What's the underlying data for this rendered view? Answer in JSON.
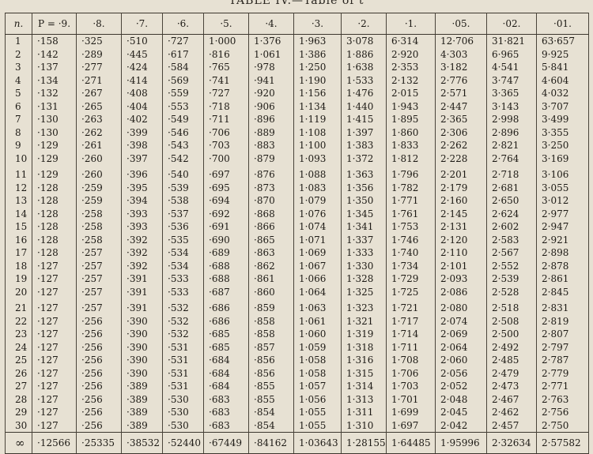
{
  "title": "TABLE IV.—Table of t",
  "columns": [
    "n.",
    "P = ·9.",
    "·8.",
    "·7.",
    "·6.",
    "·5.",
    "·4.",
    "·3.",
    "·2.",
    "·1.",
    "·05.",
    "·02.",
    "·01."
  ],
  "rows": [
    [
      "1",
      "·158",
      "·325",
      "·510",
      "·727",
      "1·000",
      "1·376",
      "1·963",
      "3·078",
      "6·314",
      "12·706",
      "31·821",
      "63·657"
    ],
    [
      "2",
      "·142",
      "·289",
      "·445",
      "·617",
      "·816",
      "1·061",
      "1·386",
      "1·886",
      "2·920",
      "4·303",
      "6·965",
      "9·925"
    ],
    [
      "3",
      "·137",
      "·277",
      "·424",
      "·584",
      "·765",
      "·978",
      "1·250",
      "1·638",
      "2·353",
      "3·182",
      "4·541",
      "5·841"
    ],
    [
      "4",
      "·134",
      "·271",
      "·414",
      "·569",
      "·741",
      "·941",
      "1·190",
      "1·533",
      "2·132",
      "2·776",
      "3·747",
      "4·604"
    ],
    [
      "5",
      "·132",
      "·267",
      "·408",
      "·559",
      "·727",
      "·920",
      "1·156",
      "1·476",
      "2·015",
      "2·571",
      "3·365",
      "4·032"
    ],
    [
      "6",
      "·131",
      "·265",
      "·404",
      "·553",
      "·718",
      "·906",
      "1·134",
      "1·440",
      "1·943",
      "2·447",
      "3·143",
      "3·707"
    ],
    [
      "7",
      "·130",
      "·263",
      "·402",
      "·549",
      "·711",
      "·896",
      "1·119",
      "1·415",
      "1·895",
      "2·365",
      "2·998",
      "3·499"
    ],
    [
      "8",
      "·130",
      "·262",
      "·399",
      "·546",
      "·706",
      "·889",
      "1·108",
      "1·397",
      "1·860",
      "2·306",
      "2·896",
      "3·355"
    ],
    [
      "9",
      "·129",
      "·261",
      "·398",
      "·543",
      "·703",
      "·883",
      "1·100",
      "1·383",
      "1·833",
      "2·262",
      "2·821",
      "3·250"
    ],
    [
      "10",
      "·129",
      "·260",
      "·397",
      "·542",
      "·700",
      "·879",
      "1·093",
      "1·372",
      "1·812",
      "2·228",
      "2·764",
      "3·169"
    ],
    [
      "11",
      "·129",
      "·260",
      "·396",
      "·540",
      "·697",
      "·876",
      "1·088",
      "1·363",
      "1·796",
      "2·201",
      "2·718",
      "3·106"
    ],
    [
      "12",
      "·128",
      "·259",
      "·395",
      "·539",
      "·695",
      "·873",
      "1·083",
      "1·356",
      "1·782",
      "2·179",
      "2·681",
      "3·055"
    ],
    [
      "13",
      "·128",
      "·259",
      "·394",
      "·538",
      "·694",
      "·870",
      "1·079",
      "1·350",
      "1·771",
      "2·160",
      "2·650",
      "3·012"
    ],
    [
      "14",
      "·128",
      "·258",
      "·393",
      "·537",
      "·692",
      "·868",
      "1·076",
      "1·345",
      "1·761",
      "2·145",
      "2·624",
      "2·977"
    ],
    [
      "15",
      "·128",
      "·258",
      "·393",
      "·536",
      "·691",
      "·866",
      "1·074",
      "1·341",
      "1·753",
      "2·131",
      "2·602",
      "2·947"
    ],
    [
      "16",
      "·128",
      "·258",
      "·392",
      "·535",
      "·690",
      "·865",
      "1·071",
      "1·337",
      "1·746",
      "2·120",
      "2·583",
      "2·921"
    ],
    [
      "17",
      "·128",
      "·257",
      "·392",
      "·534",
      "·689",
      "·863",
      "1·069",
      "1·333",
      "1·740",
      "2·110",
      "2·567",
      "2·898"
    ],
    [
      "18",
      "·127",
      "·257",
      "·392",
      "·534",
      "·688",
      "·862",
      "1·067",
      "1·330",
      "1·734",
      "2·101",
      "2·552",
      "2·878"
    ],
    [
      "19",
      "·127",
      "·257",
      "·391",
      "·533",
      "·688",
      "·861",
      "1·066",
      "1·328",
      "1·729",
      "2·093",
      "2·539",
      "2·861"
    ],
    [
      "20",
      "·127",
      "·257",
      "·391",
      "·533",
      "·687",
      "·860",
      "1·064",
      "1·325",
      "1·725",
      "2·086",
      "2·528",
      "2·845"
    ],
    [
      "21",
      "·127",
      "·257",
      "·391",
      "·532",
      "·686",
      "·859",
      "1·063",
      "1·323",
      "1·721",
      "2·080",
      "2·518",
      "2·831"
    ],
    [
      "22",
      "·127",
      "·256",
      "·390",
      "·532",
      "·686",
      "·858",
      "1·061",
      "1·321",
      "1·717",
      "2·074",
      "2·508",
      "2·819"
    ],
    [
      "23",
      "·127",
      "·256",
      "·390",
      "·532",
      "·685",
      "·858",
      "1·060",
      "1·319",
      "1·714",
      "2·069",
      "2·500",
      "2·807"
    ],
    [
      "24",
      "·127",
      "·256",
      "·390",
      "·531",
      "·685",
      "·857",
      "1·059",
      "1·318",
      "1·711",
      "2·064",
      "2·492",
      "2·797"
    ],
    [
      "25",
      "·127",
      "·256",
      "·390",
      "·531",
      "·684",
      "·856",
      "1·058",
      "1·316",
      "1·708",
      "2·060",
      "2·485",
      "2·787"
    ],
    [
      "26",
      "·127",
      "·256",
      "·390",
      "·531",
      "·684",
      "·856",
      "1·058",
      "1·315",
      "1·706",
      "2·056",
      "2·479",
      "2·779"
    ],
    [
      "27",
      "·127",
      "·256",
      "·389",
      "·531",
      "·684",
      "·855",
      "1·057",
      "1·314",
      "1·703",
      "2·052",
      "2·473",
      "2·771"
    ],
    [
      "28",
      "·127",
      "·256",
      "·389",
      "·530",
      "·683",
      "·855",
      "1·056",
      "1·313",
      "1·701",
      "2·048",
      "2·467",
      "2·763"
    ],
    [
      "29",
      "·127",
      "·256",
      "·389",
      "·530",
      "·683",
      "·854",
      "1·055",
      "1·311",
      "1·699",
      "2·045",
      "2·462",
      "2·756"
    ],
    [
      "30",
      "·127",
      "·256",
      "·389",
      "·530",
      "·683",
      "·854",
      "1·055",
      "1·310",
      "1·697",
      "2·042",
      "2·457",
      "2·750"
    ],
    [
      "∞",
      "·12566",
      "·25335",
      "·38532",
      "·52440",
      "·67449",
      "·84162",
      "1·03643",
      "1·28155",
      "1·64485",
      "1·95996",
      "2·32634",
      "2·57582"
    ]
  ]
}
